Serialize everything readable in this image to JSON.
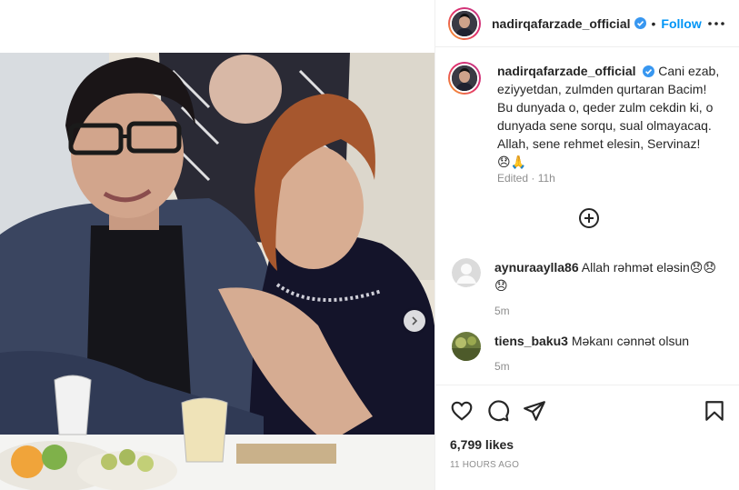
{
  "post": {
    "image_alt": "Photo of a man in glasses and a woman at a dinner table",
    "carousel_next_icon": "chevron-right-icon"
  },
  "header": {
    "username": "nadirqafarzade_official",
    "separator": "•",
    "follow_label": "Follow",
    "more_icon": "more-horizontal-icon"
  },
  "caption": {
    "username": "nadirqafarzade_official",
    "text": "Cani ezab, eziyyetdan, zulmden qurtaran Bacim! Bu dunyada o, qeder zulm cekdin ki, o dunyada sene sorqu, sual olmayacaq. Allah, sene rehmet elesin, Servinaz!",
    "emojis": "😞🙏",
    "meta": "Edited · 11h"
  },
  "load_more_icon": "plus-circle-icon",
  "comments": [
    {
      "username": "aynuraaylla86",
      "text": "Allah rəhmət eləsin😞😞😞",
      "time": "5m"
    },
    {
      "username": "tiens_baku3",
      "text": "Məkanı cənnət olsun",
      "time": "5m"
    }
  ],
  "actions": {
    "like_icon": "heart-icon",
    "comment_icon": "comment-icon",
    "share_icon": "paper-plane-icon",
    "save_icon": "bookmark-icon"
  },
  "likes": "6,799 likes",
  "timeago": "11 HOURS AGO",
  "colors": {
    "accent": "#0095f6",
    "text": "#262626",
    "muted": "#8e8e8e",
    "divider": "#efefef"
  }
}
